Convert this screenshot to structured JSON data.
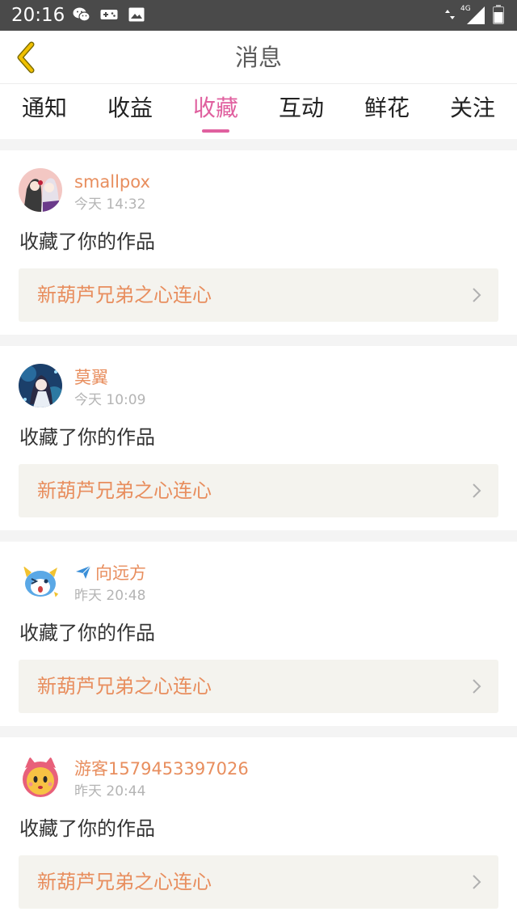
{
  "status_bar": {
    "time": "20:16",
    "icons": [
      "wechat-icon",
      "gamepad-icon",
      "image-icon",
      "data-arrows-icon",
      "signal-icon",
      "battery-icon"
    ],
    "network": "4G"
  },
  "header": {
    "title": "消息",
    "back_icon": "chevron-left-icon"
  },
  "tabs": [
    {
      "label": "通知",
      "active": false
    },
    {
      "label": "收益",
      "active": false
    },
    {
      "label": "收藏",
      "active": true
    },
    {
      "label": "互动",
      "active": false
    },
    {
      "label": "鲜花",
      "active": false
    },
    {
      "label": "关注",
      "active": false
    }
  ],
  "messages": [
    {
      "name": "smallpox",
      "time": "今天 14:32",
      "action": "收藏了你的作品",
      "work": "新葫芦兄弟之心连心",
      "avatar": "anime-girls-avatar"
    },
    {
      "name": "莫翼",
      "time": "今天 10:09",
      "action": "收藏了你的作品",
      "work": "新葫芦兄弟之心连心",
      "avatar": "blue-anime-avatar"
    },
    {
      "name": "向远方",
      "name_icon": "airplane-icon",
      "time": "昨天 20:48",
      "action": "收藏了你的作品",
      "work": "新葫芦兄弟之心连心",
      "avatar": "blue-monster-avatar"
    },
    {
      "name": "游客1579453397026",
      "time": "昨天 20:44",
      "action": "收藏了你的作品",
      "work": "新葫芦兄弟之心连心",
      "avatar": "pink-cartoon-avatar"
    }
  ],
  "colors": {
    "accent": "#e0609f",
    "name_orange": "#e88e5e",
    "header_back": "#f0c000",
    "status_bar": "#4a4a4a",
    "work_box": "#f4f3ee"
  }
}
